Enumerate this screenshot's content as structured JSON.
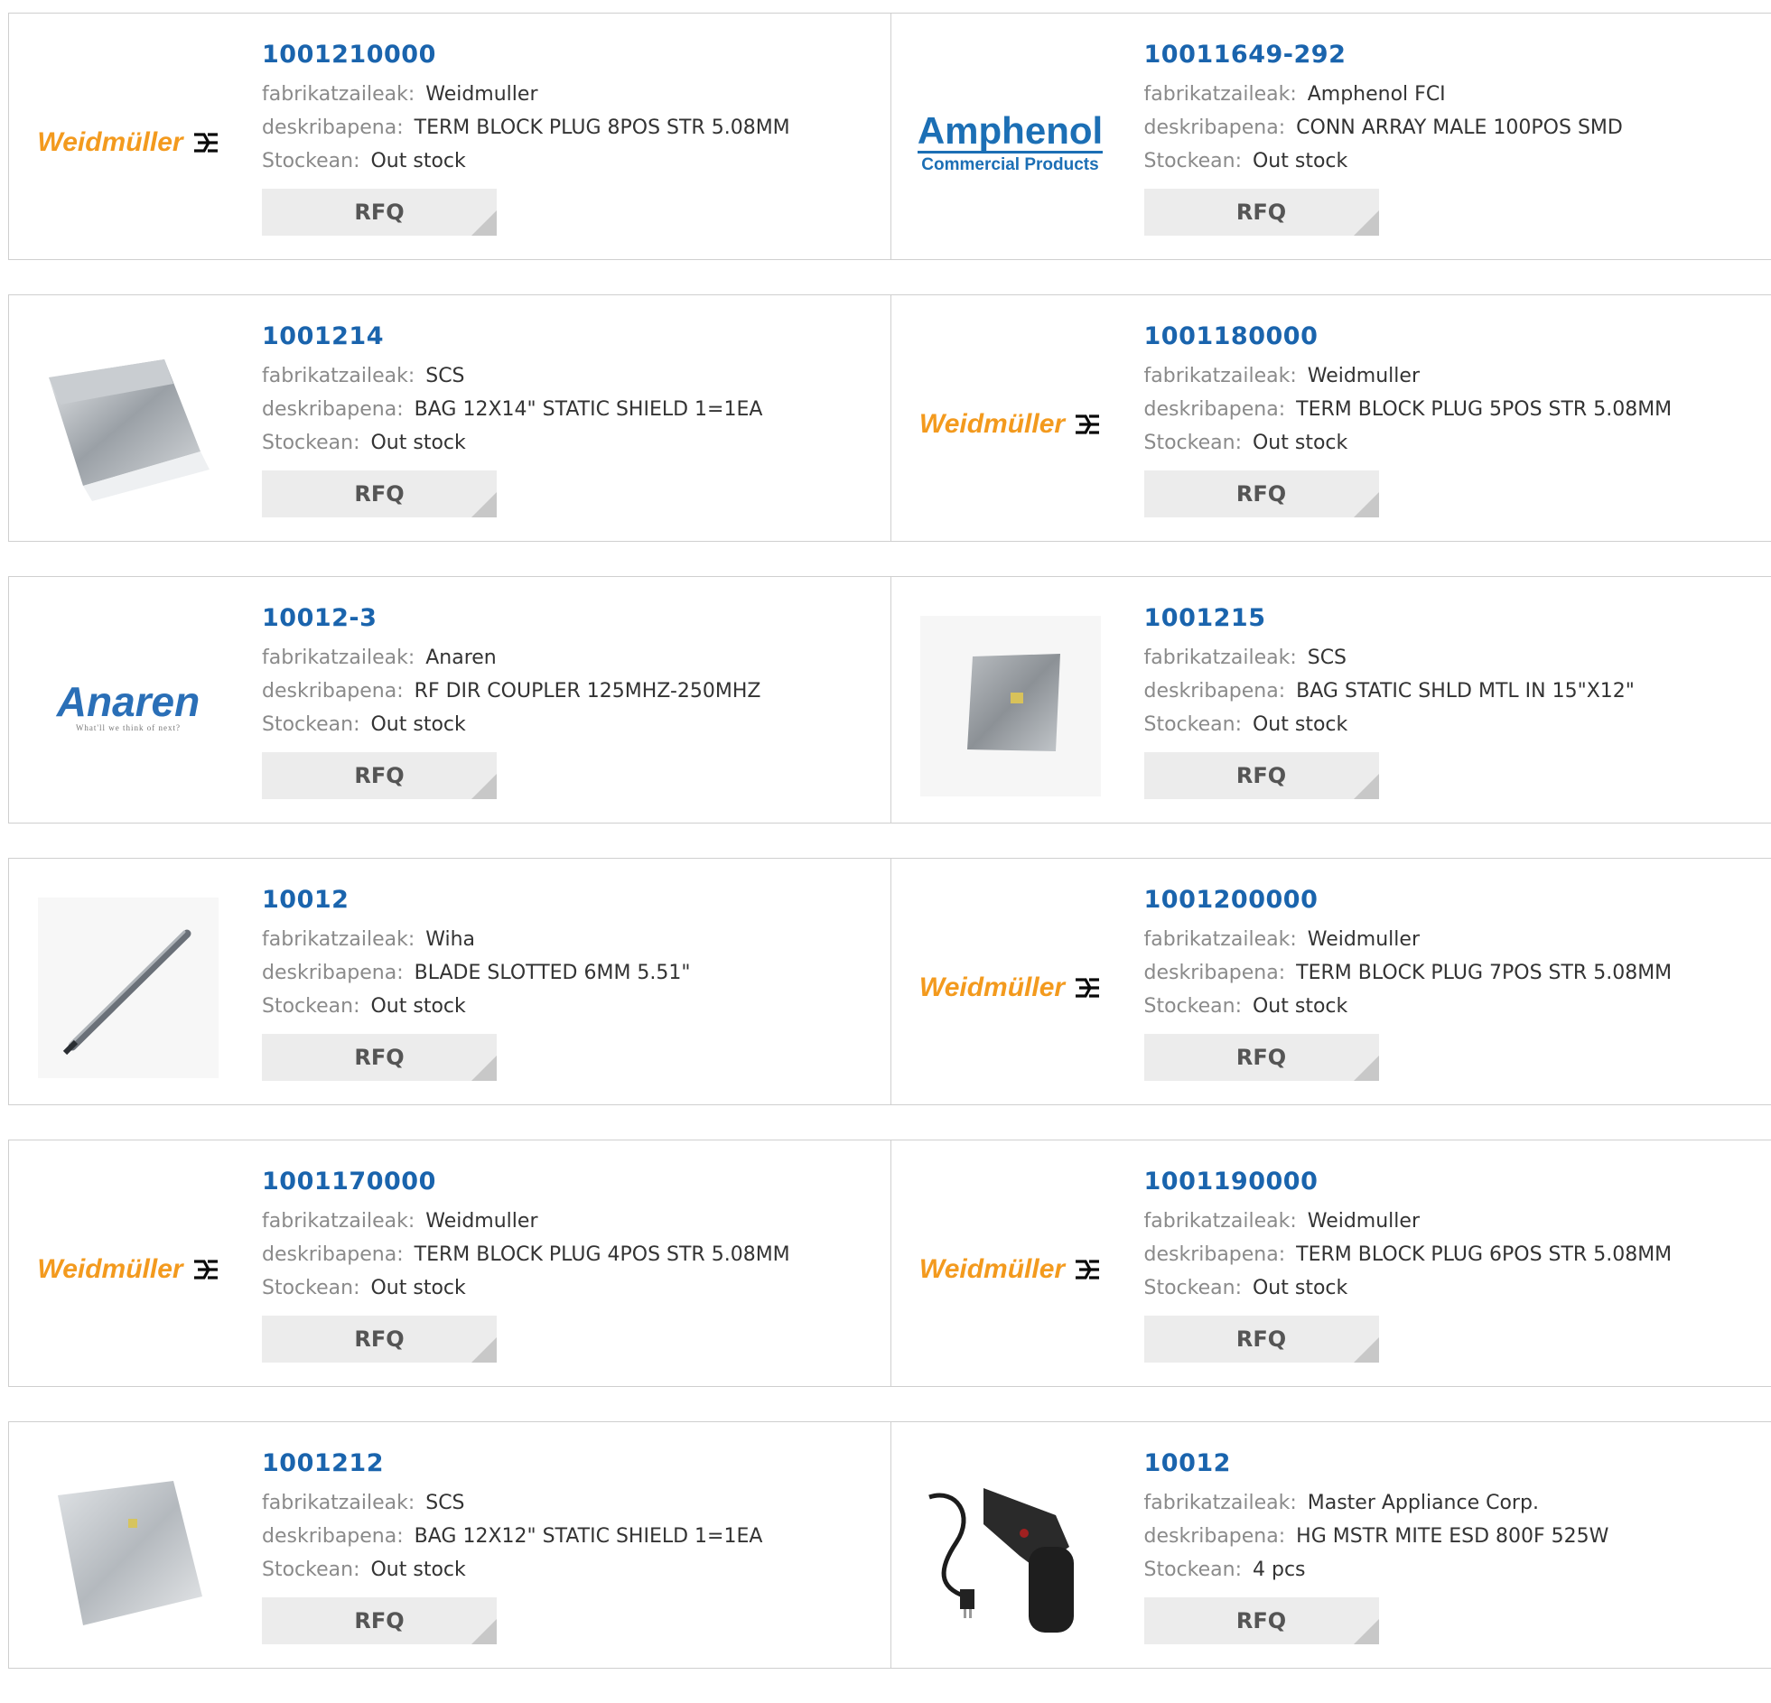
{
  "labels": {
    "manufacturer": "fabrikatzaileak:",
    "description": "deskribapena:",
    "stock": "Stockean:",
    "rfq": "RFQ"
  },
  "brand_logos": {
    "weidmuller": "Weidmüller",
    "amphenol_main": "Amphenol",
    "amphenol_sub": "Commercial Products",
    "anaren_main": "Anaren",
    "anaren_tagline": "What'll we think of next?"
  },
  "colors": {
    "part_link": "#1a64ad",
    "weidmuller_orange": "#f39a1e",
    "amphenol_blue": "#1c6fb5"
  },
  "products": [
    {
      "part": "1001210000",
      "manufacturer": "Weidmuller",
      "description": "TERM BLOCK PLUG 8POS STR 5.08MM",
      "stock": "Out stock",
      "image": "weidmuller-logo"
    },
    {
      "part": "10011649-292",
      "manufacturer": "Amphenol FCI",
      "description": "CONN ARRAY MALE 100POS SMD",
      "stock": "Out stock",
      "image": "amphenol-logo"
    },
    {
      "part": "1001214",
      "manufacturer": "SCS",
      "description": "BAG 12X14\" STATIC SHIELD 1=1EA",
      "stock": "Out stock",
      "image": "static-bag-photo"
    },
    {
      "part": "1001180000",
      "manufacturer": "Weidmuller",
      "description": "TERM BLOCK PLUG 5POS STR 5.08MM",
      "stock": "Out stock",
      "image": "weidmuller-logo"
    },
    {
      "part": "10012-3",
      "manufacturer": "Anaren",
      "description": "RF DIR COUPLER 125MHZ-250MHZ",
      "stock": "Out stock",
      "image": "anaren-logo"
    },
    {
      "part": "1001215",
      "manufacturer": "SCS",
      "description": "BAG STATIC SHLD MTL IN 15\"X12\"",
      "stock": "Out stock",
      "image": "static-bag-square-photo"
    },
    {
      "part": "10012",
      "manufacturer": "Wiha",
      "description": "BLADE SLOTTED 6MM 5.51\"",
      "stock": "Out stock",
      "image": "screwdriver-blade-photo"
    },
    {
      "part": "1001200000",
      "manufacturer": "Weidmuller",
      "description": "TERM BLOCK PLUG 7POS STR 5.08MM",
      "stock": "Out stock",
      "image": "weidmuller-logo"
    },
    {
      "part": "1001170000",
      "manufacturer": "Weidmuller",
      "description": "TERM BLOCK PLUG 4POS STR 5.08MM",
      "stock": "Out stock",
      "image": "weidmuller-logo"
    },
    {
      "part": "1001190000",
      "manufacturer": "Weidmuller",
      "description": "TERM BLOCK PLUG 6POS STR 5.08MM",
      "stock": "Out stock",
      "image": "weidmuller-logo"
    },
    {
      "part": "1001212",
      "manufacturer": "SCS",
      "description": "BAG 12X12\" STATIC SHIELD 1=1EA",
      "stock": "Out stock",
      "image": "static-bag-photo"
    },
    {
      "part": "10012",
      "manufacturer": "Master Appliance Corp.",
      "description": "HG MSTR MITE ESD 800F 525W",
      "stock": "4 pcs",
      "image": "heat-gun-photo"
    }
  ]
}
